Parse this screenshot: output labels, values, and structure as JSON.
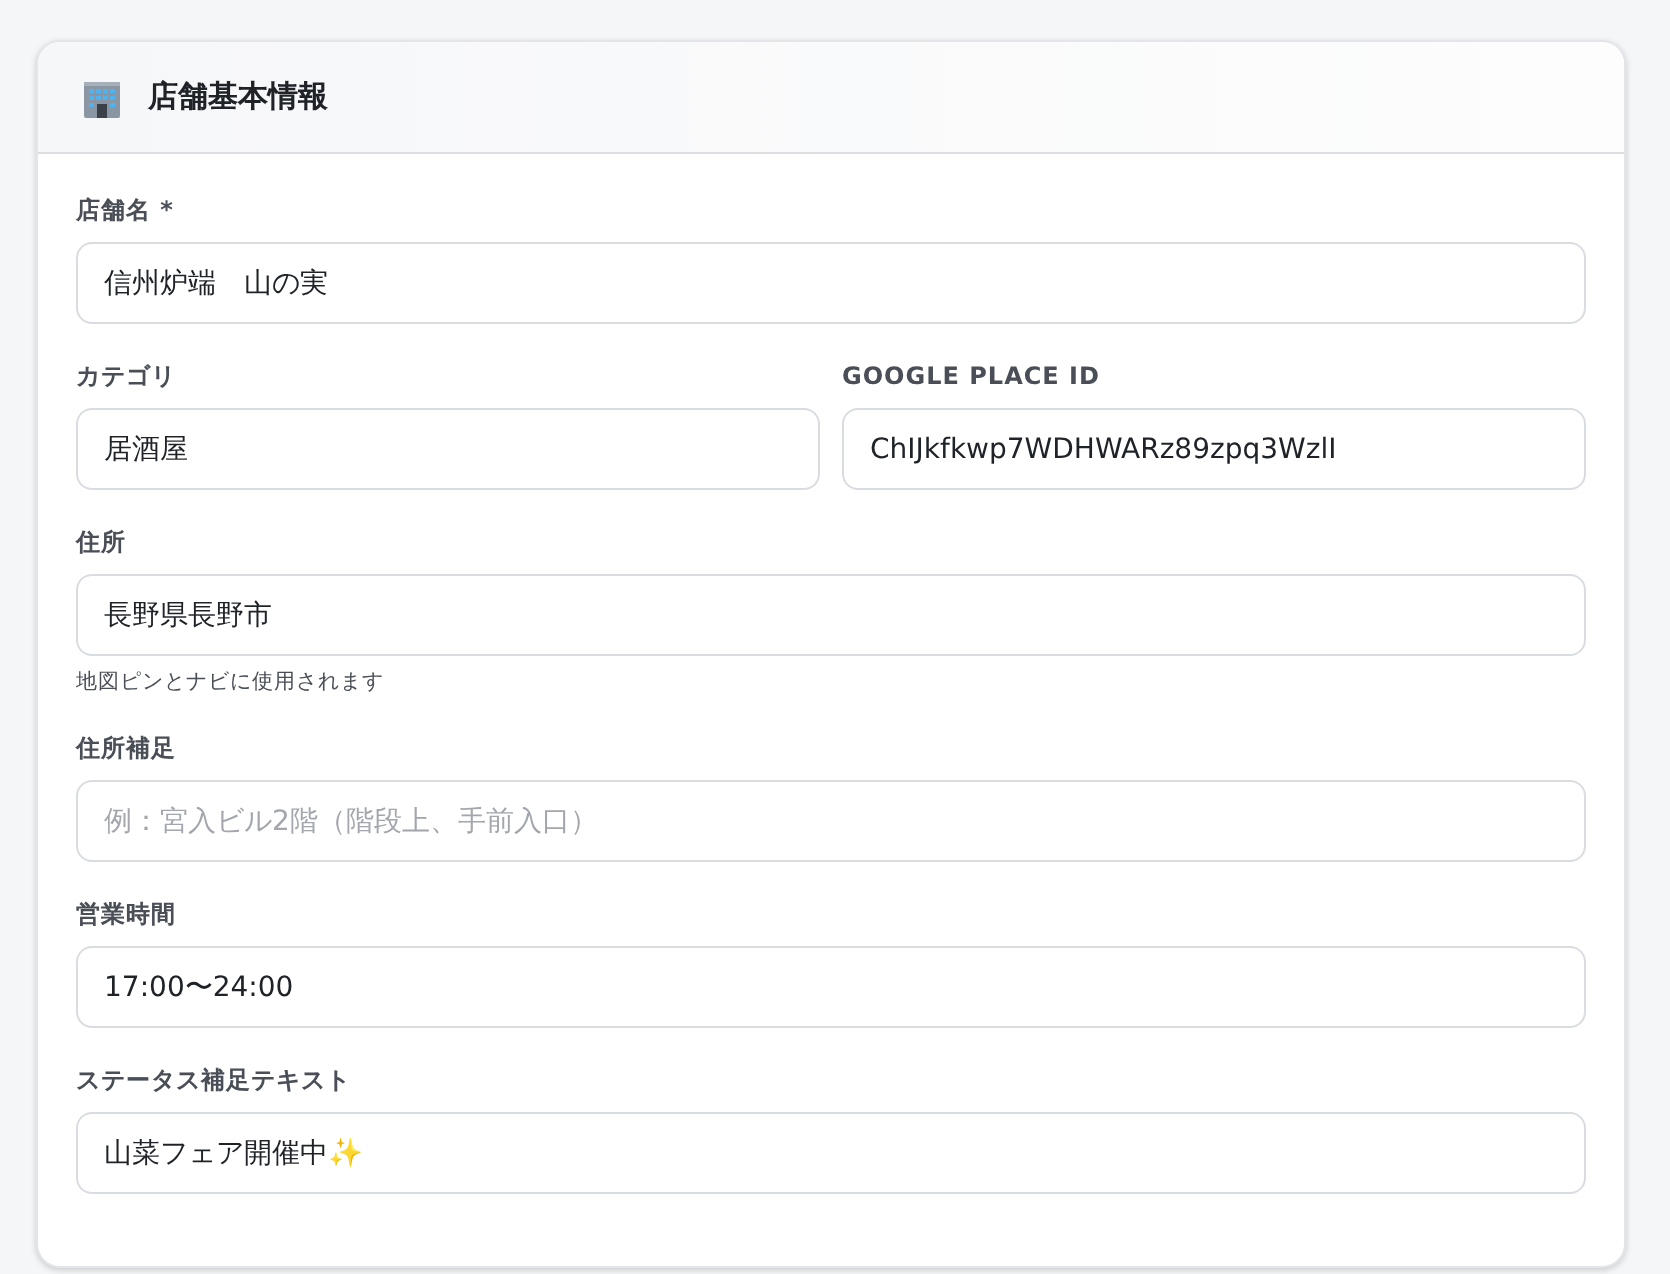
{
  "card": {
    "title": "店舗基本情報"
  },
  "rows": [
    [
      {
        "label": "店舗名 *",
        "value": "信州炉端　山の実"
      }
    ],
    [
      {
        "label": "カテゴリ",
        "value": "居酒屋"
      },
      {
        "label": "GOOGLE PLACE ID",
        "value": "ChIJkfkwp7WDHWARz89zpq3WzlI"
      }
    ],
    [
      {
        "label": "住所",
        "value": "長野県長野市",
        "helper": "地図ピンとナビに使用されます"
      }
    ],
    [
      {
        "label": "住所補足",
        "placeholder": "例：宮入ビル2階（階段上、手前入口）"
      }
    ],
    [
      {
        "label": "営業時間",
        "value": "17:00〜24:00"
      }
    ],
    [
      {
        "label": "ステータス補足テキスト",
        "value": "山菜フェア開催中✨"
      }
    ]
  ]
}
